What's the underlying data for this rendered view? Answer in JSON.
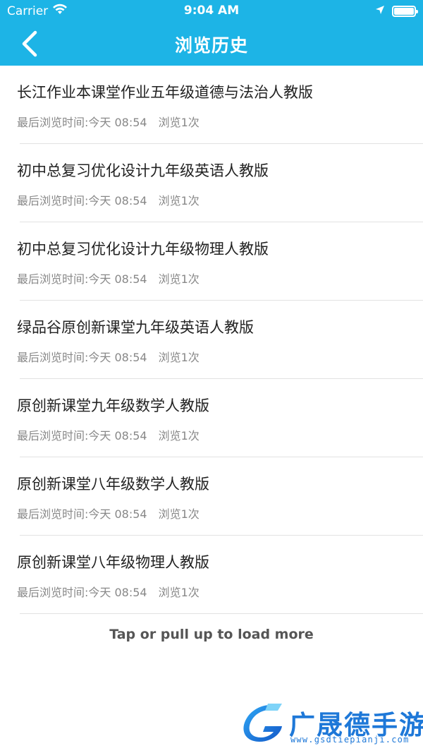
{
  "status_bar": {
    "carrier": "Carrier",
    "time": "9:04 AM"
  },
  "nav": {
    "title": "浏览历史"
  },
  "history": [
    {
      "title": "长江作业本课堂作业五年级道德与法治人教版",
      "last_viewed": "最后浏览时间:今天 08:54",
      "views": "浏览1次"
    },
    {
      "title": "初中总复习优化设计九年级英语人教版",
      "last_viewed": "最后浏览时间:今天 08:54",
      "views": "浏览1次"
    },
    {
      "title": "初中总复习优化设计九年级物理人教版",
      "last_viewed": "最后浏览时间:今天 08:54",
      "views": "浏览1次"
    },
    {
      "title": "绿品谷原创新课堂九年级英语人教版",
      "last_viewed": "最后浏览时间:今天 08:54",
      "views": "浏览1次"
    },
    {
      "title": "原创新课堂九年级数学人教版",
      "last_viewed": "最后浏览时间:今天 08:54",
      "views": "浏览1次"
    },
    {
      "title": "原创新课堂八年级数学人教版",
      "last_viewed": "最后浏览时间:今天 08:54",
      "views": "浏览1次"
    },
    {
      "title": "原创新课堂八年级物理人教版",
      "last_viewed": "最后浏览时间:今天 08:54",
      "views": "浏览1次"
    }
  ],
  "load_more": "Tap or pull up to load more",
  "watermark": {
    "brand": "广晟德手游",
    "url": "www.gsdtiepianji.com"
  },
  "colors": {
    "header": "#1DB4E6",
    "watermark": "#1E78D8"
  }
}
